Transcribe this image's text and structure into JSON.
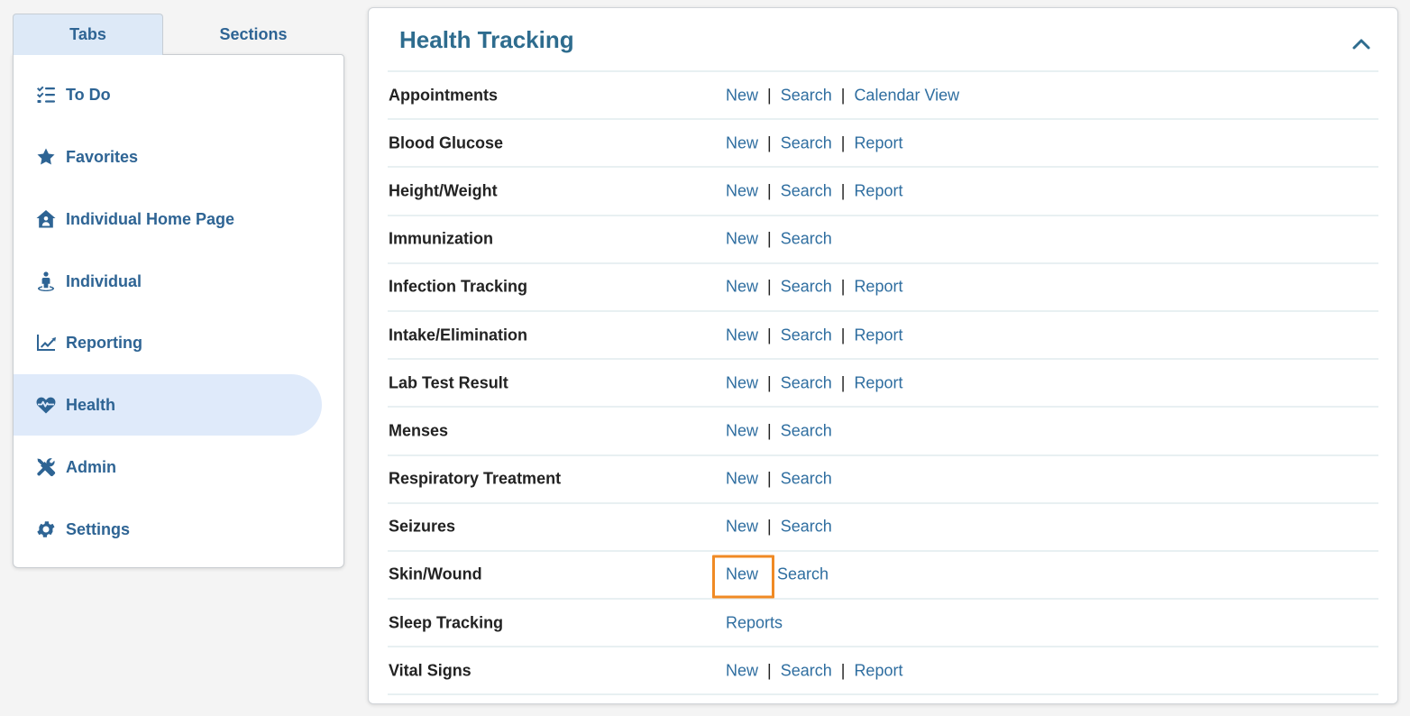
{
  "nav": {
    "tabs": [
      {
        "label": "Tabs",
        "active": true
      },
      {
        "label": "Sections",
        "active": false
      }
    ],
    "items": [
      {
        "label": "To Do",
        "icon": "todo-list-icon"
      },
      {
        "label": "Favorites",
        "icon": "star-icon"
      },
      {
        "label": "Individual Home Page",
        "icon": "home-person-icon"
      },
      {
        "label": "Individual",
        "icon": "person-icon"
      },
      {
        "label": "Reporting",
        "icon": "line-chart-icon"
      },
      {
        "label": "Health",
        "icon": "heart-pulse-icon",
        "active": true
      },
      {
        "label": "Admin",
        "icon": "tools-icon"
      },
      {
        "label": "Settings",
        "icon": "gear-icon"
      }
    ]
  },
  "health": {
    "title": "Health Tracking",
    "rows": [
      {
        "label": "Appointments",
        "links": [
          "New",
          "Search",
          "Calendar View"
        ]
      },
      {
        "label": "Blood Glucose",
        "links": [
          "New",
          "Search",
          "Report"
        ]
      },
      {
        "label": "Height/Weight",
        "links": [
          "New",
          "Search",
          "Report"
        ]
      },
      {
        "label": "Immunization",
        "links": [
          "New",
          "Search"
        ]
      },
      {
        "label": "Infection Tracking",
        "links": [
          "New",
          "Search",
          "Report"
        ]
      },
      {
        "label": "Intake/Elimination",
        "links": [
          "New",
          "Search",
          "Report"
        ]
      },
      {
        "label": "Lab Test Result",
        "links": [
          "New",
          "Search",
          "Report"
        ]
      },
      {
        "label": "Menses",
        "links": [
          "New",
          "Search"
        ]
      },
      {
        "label": "Respiratory Treatment",
        "links": [
          "New",
          "Search"
        ]
      },
      {
        "label": "Seizures",
        "links": [
          "New",
          "Search"
        ]
      },
      {
        "label": "Skin/Wound",
        "links": [
          "New",
          "Search"
        ],
        "highlight_link": 0
      },
      {
        "label": "Sleep Tracking",
        "links": [
          "Reports"
        ]
      },
      {
        "label": "Vital Signs",
        "links": [
          "New",
          "Search",
          "Report"
        ]
      }
    ]
  },
  "colors": {
    "accent": "#2e6494",
    "link": "#2f6ea0",
    "title": "#2e6c8e",
    "highlight": "#f08a24",
    "active_bg": "#dfeafa"
  }
}
